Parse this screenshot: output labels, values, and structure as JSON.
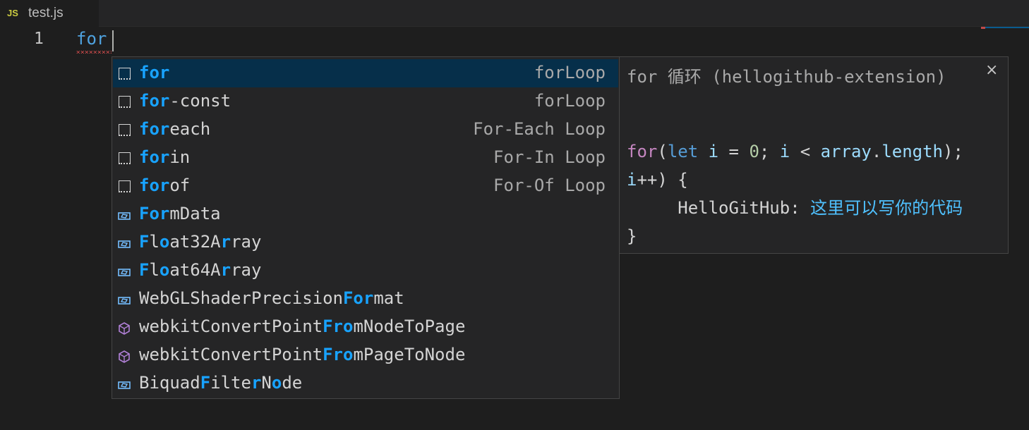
{
  "tab": {
    "icon": "JS",
    "filename": "test.js"
  },
  "editor": {
    "line_number": "1",
    "code": "for"
  },
  "suggestions": [
    {
      "kind": "snippet-icon",
      "match": "for",
      "rest": "",
      "detail": "forLoop",
      "selected": true
    },
    {
      "kind": "snippet-icon",
      "match": "for",
      "rest": "-const",
      "detail": "forLoop"
    },
    {
      "kind": "snippet-icon",
      "match": "for",
      "rest": "each",
      "detail": "For-Each Loop"
    },
    {
      "kind": "snippet-icon",
      "match": "for",
      "rest": "in",
      "detail": "For-In Loop"
    },
    {
      "kind": "snippet-icon",
      "match": "for",
      "rest": "of",
      "detail": "For-Of Loop"
    },
    {
      "kind": "variable-icon",
      "parts": [
        [
          "For",
          true
        ],
        [
          "mData",
          false
        ]
      ]
    },
    {
      "kind": "variable-icon",
      "parts": [
        [
          "F",
          true
        ],
        [
          "l",
          false
        ],
        [
          "o",
          true
        ],
        [
          "at32A",
          false
        ],
        [
          "r",
          true
        ],
        [
          "ray",
          false
        ]
      ]
    },
    {
      "kind": "variable-icon",
      "parts": [
        [
          "F",
          true
        ],
        [
          "l",
          false
        ],
        [
          "o",
          true
        ],
        [
          "at64A",
          false
        ],
        [
          "r",
          true
        ],
        [
          "ray",
          false
        ]
      ]
    },
    {
      "kind": "variable-icon",
      "parts": [
        [
          "WebGLShaderPrecision",
          false
        ],
        [
          "For",
          true
        ],
        [
          "mat",
          false
        ]
      ]
    },
    {
      "kind": "method-icon",
      "parts": [
        [
          "webkitConvertPoint",
          false
        ],
        [
          "Fro",
          true
        ],
        [
          "mNodeToPage",
          false
        ]
      ]
    },
    {
      "kind": "method-icon",
      "parts": [
        [
          "webkitConvertPoint",
          false
        ],
        [
          "Fro",
          true
        ],
        [
          "mPageToNode",
          false
        ]
      ]
    },
    {
      "kind": "variable-icon",
      "parts": [
        [
          "Biquad",
          false
        ],
        [
          "F",
          true
        ],
        [
          "ilte",
          false
        ],
        [
          "r",
          true
        ],
        [
          "N",
          false
        ],
        [
          "o",
          true
        ],
        [
          "de",
          false
        ]
      ]
    }
  ],
  "details": {
    "title": "for 循环 (hellogithub-extension)",
    "close": "×",
    "code_lines": [
      [
        [
          "for",
          "kw"
        ],
        [
          "(",
          ""
        ],
        [
          "let",
          "kw2"
        ],
        [
          " ",
          ""
        ],
        [
          "i",
          "var"
        ],
        [
          " = ",
          ""
        ],
        [
          "0",
          "num"
        ],
        [
          "; ",
          ""
        ],
        [
          "i",
          "var"
        ],
        [
          " < ",
          ""
        ],
        [
          "array",
          "var"
        ],
        [
          ".",
          ""
        ],
        [
          "length",
          "prop"
        ],
        [
          ");",
          ""
        ]
      ],
      [
        [
          "i",
          "var"
        ],
        [
          "++) {",
          ""
        ]
      ],
      [
        [
          "     HelloGitHub: ",
          ""
        ],
        [
          "这里可以写你的代码",
          "ph"
        ]
      ],
      [
        [
          "}",
          ""
        ]
      ]
    ]
  }
}
